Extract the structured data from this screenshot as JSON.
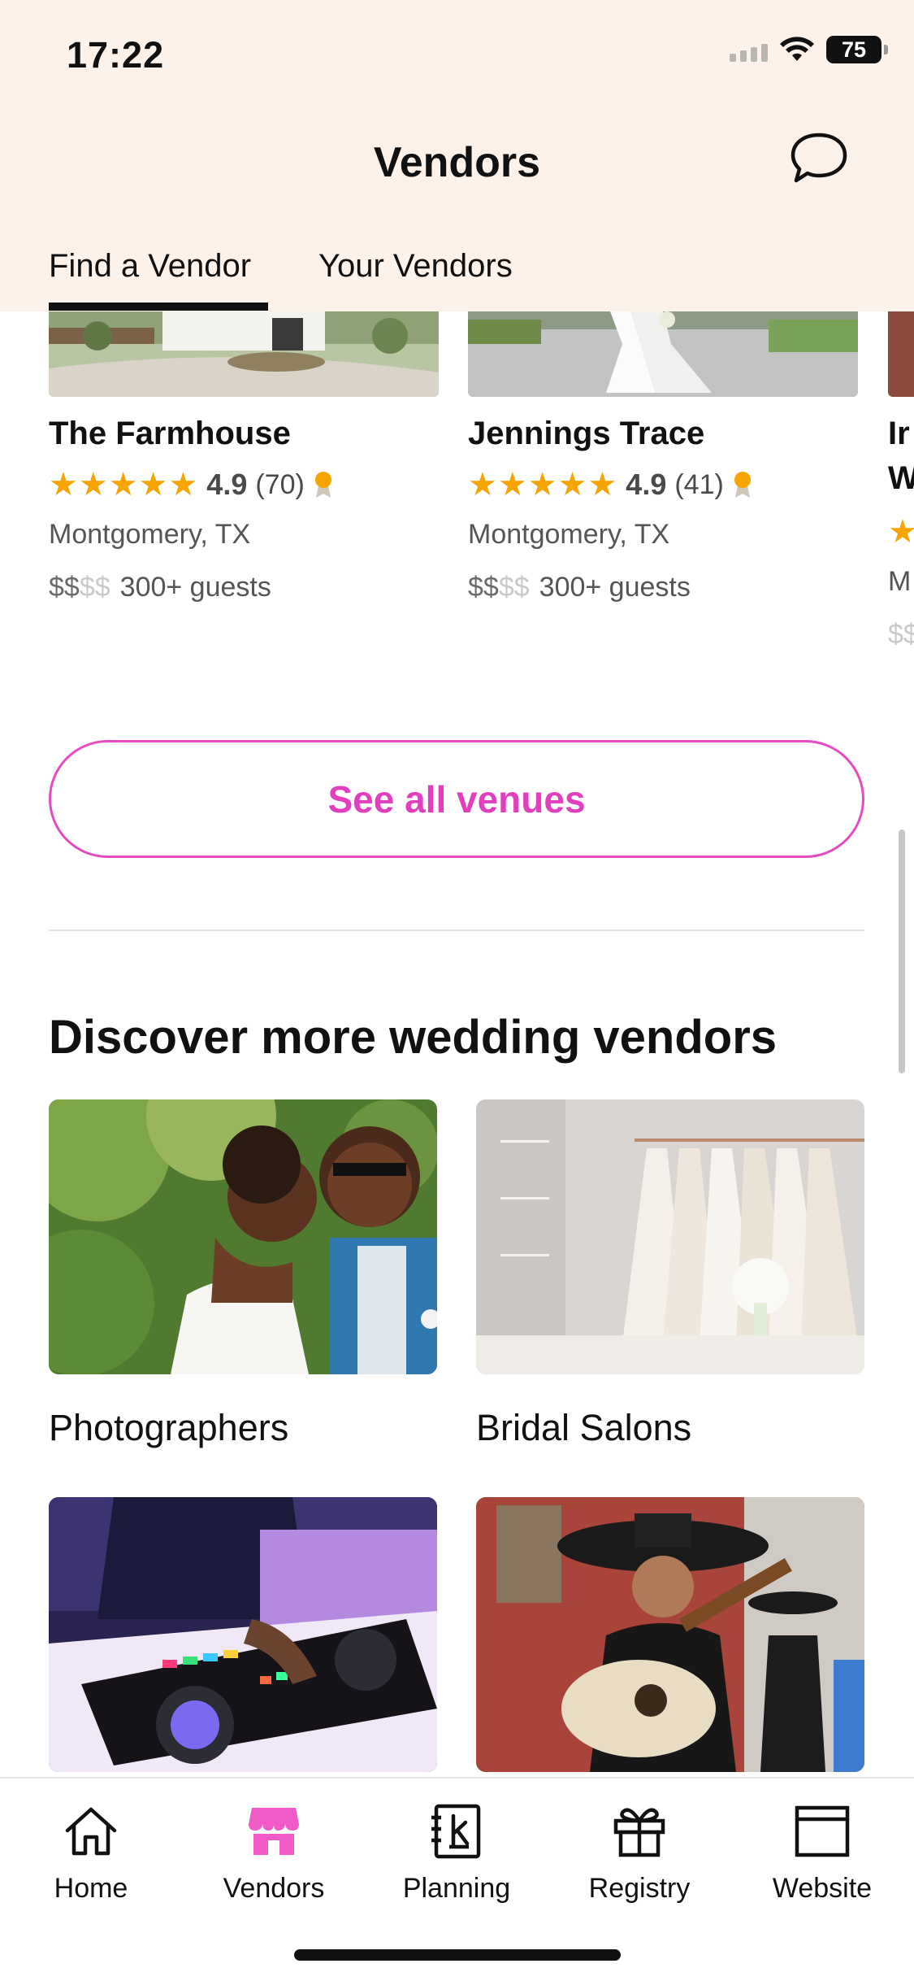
{
  "status_bar": {
    "time": "17:22",
    "battery": "75"
  },
  "header": {
    "title": "Vendors"
  },
  "tabs": [
    {
      "label": "Find a Vendor",
      "active": true
    },
    {
      "label": "Your Vendors",
      "active": false
    }
  ],
  "venues": [
    {
      "name": "The Farmhouse",
      "rating": "4.9",
      "reviews": "(70)",
      "location": "Montgomery, TX",
      "price_on": "$$",
      "price_off": "$$",
      "guests": "300+ guests"
    },
    {
      "name": "Jennings Trace",
      "rating": "4.9",
      "reviews": "(41)",
      "location": "Montgomery, TX",
      "price_on": "$$",
      "price_off": "$$",
      "guests": "300+ guests"
    },
    {
      "name": "Ir",
      "name2": "W",
      "location": "M",
      "price": "$$"
    }
  ],
  "stars": "★★★★★",
  "see_all": "See all venues",
  "discover": {
    "title": "Discover more wedding vendors",
    "categories": [
      {
        "label": "Photographers"
      },
      {
        "label": "Bridal Salons"
      },
      {
        "label": ""
      },
      {
        "label": ""
      }
    ]
  },
  "bottom_nav": [
    {
      "label": "Home",
      "icon": "home-icon"
    },
    {
      "label": "Vendors",
      "icon": "storefront-icon",
      "active": true
    },
    {
      "label": "Planning",
      "icon": "planner-icon"
    },
    {
      "label": "Registry",
      "icon": "gift-icon"
    },
    {
      "label": "Website",
      "icon": "browser-window-icon"
    }
  ],
  "colors": {
    "accent": "#e23fbe",
    "star": "#f6a400",
    "header_bg": "#fdf2ea"
  }
}
